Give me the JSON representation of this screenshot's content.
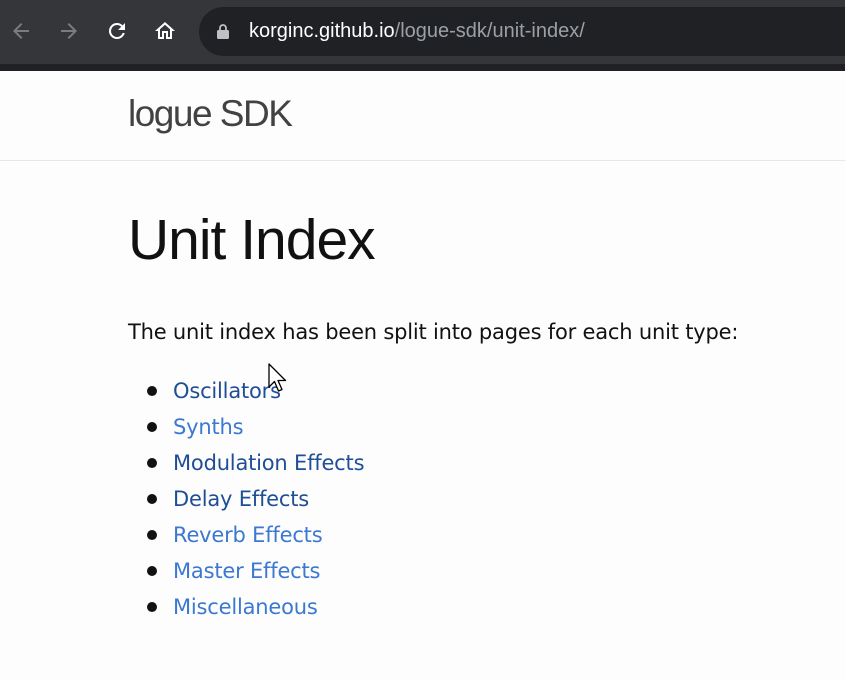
{
  "browser": {
    "url_host": "korginc.github.io",
    "url_path": "/logue-sdk/unit-index/"
  },
  "site": {
    "title": "logue SDK"
  },
  "page": {
    "heading": "Unit Index",
    "intro": "The unit index has been split into pages for each unit type:",
    "links": [
      {
        "label": "Oscillators",
        "visited": true
      },
      {
        "label": "Synths",
        "visited": false
      },
      {
        "label": "Modulation Effects",
        "visited": true
      },
      {
        "label": "Delay Effects",
        "visited": true
      },
      {
        "label": "Reverb Effects",
        "visited": false
      },
      {
        "label": "Master Effects",
        "visited": false
      },
      {
        "label": "Miscellaneous",
        "visited": false
      }
    ]
  },
  "colors": {
    "link_visited": "#1f4e96",
    "link_unvisited": "#3b78d1",
    "toolbar": "#35363a",
    "omnibox": "#202124"
  }
}
